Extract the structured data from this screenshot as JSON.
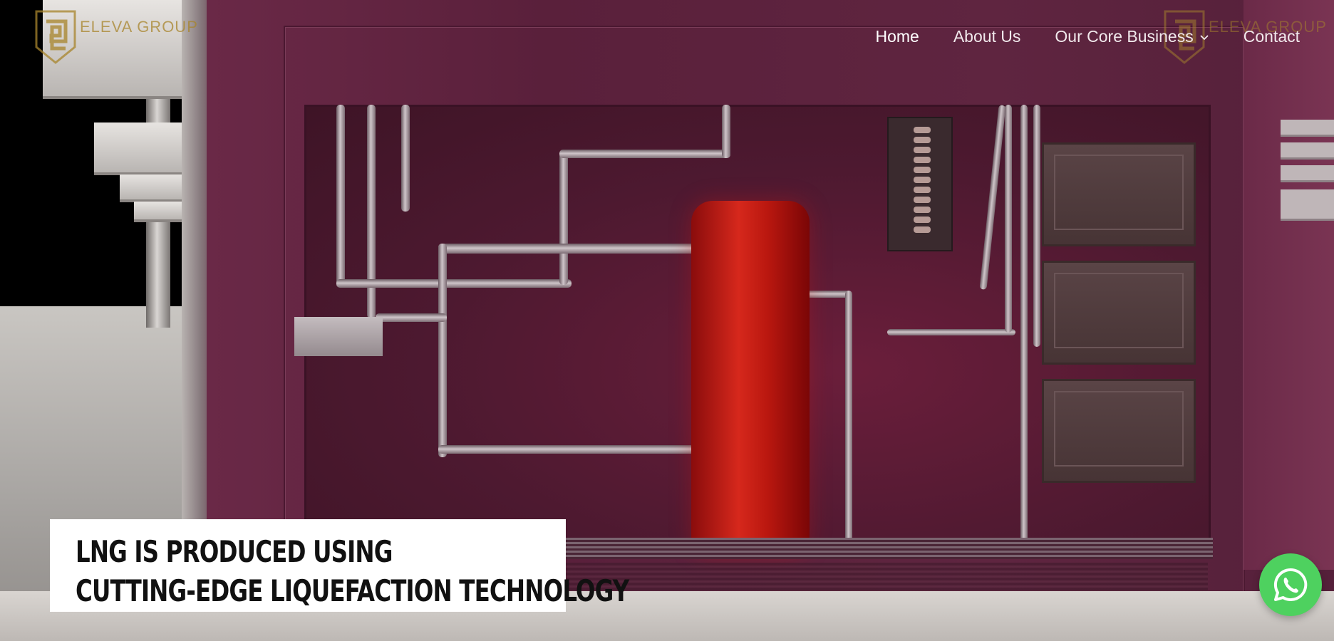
{
  "brand": {
    "logo_text": "ELEVA GROUP",
    "logo_color": "#a8852c",
    "logo_icon": "eleva-shield-logo-icon"
  },
  "nav": {
    "items": [
      {
        "label": "Home",
        "active": true
      },
      {
        "label": "About Us",
        "active": false
      },
      {
        "label": "Our Core Business",
        "active": false,
        "has_dropdown": true,
        "dropdown_icon": "chevron-down-icon"
      },
      {
        "label": "Contact",
        "active": false
      }
    ]
  },
  "hero": {
    "caption_line1": "LNG IS PRODUCED USING",
    "caption_line2": "CUTTING-EDGE LIQUEFACTION TECHNOLOGY",
    "scene_colors": {
      "container": "#5a203b",
      "tank": "#c41e14"
    }
  },
  "whatsapp": {
    "icon": "whatsapp-icon",
    "color": "#4ed15f"
  }
}
